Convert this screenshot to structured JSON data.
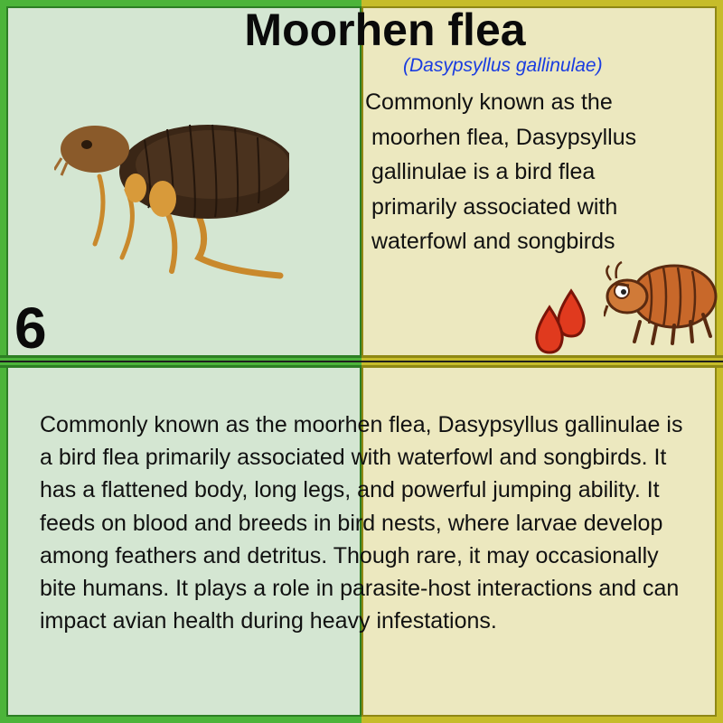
{
  "card": {
    "title": "Moorhen flea",
    "scientific_name": "(Dasypsyllus gallinulae)",
    "short_lines": [
      "Commonly known as the",
      " moorhen flea, Dasypsyllus",
      " gallinulae is a bird flea",
      " primarily associated with",
      " waterfowl and songbirds"
    ],
    "number": "6",
    "description": "Commonly known as the moorhen flea, Dasypsyllus gallinulae is a bird flea primarily associated with waterfowl and songbirds. It has a flattened body, long legs, and powerful jumping ability. It feeds on blood and breeds in bird nests, where larvae develop among feathers and detritus. Though rare, it may occasionally bite humans. It plays a role in parasite-host interactions and can impact avian health during heavy infestations.",
    "icons": {
      "photo": "flea-photo",
      "drops": "blood-drops-icon",
      "cartoon": "cartoon-flea-icon"
    },
    "colors": {
      "left_bg": "#d4e6d2",
      "right_bg": "#ece8bf",
      "left_border": "#4cb43a",
      "right_border": "#c6bc2a",
      "scientific_name": "#1a3ce0",
      "blood": "#e03a1e"
    }
  }
}
